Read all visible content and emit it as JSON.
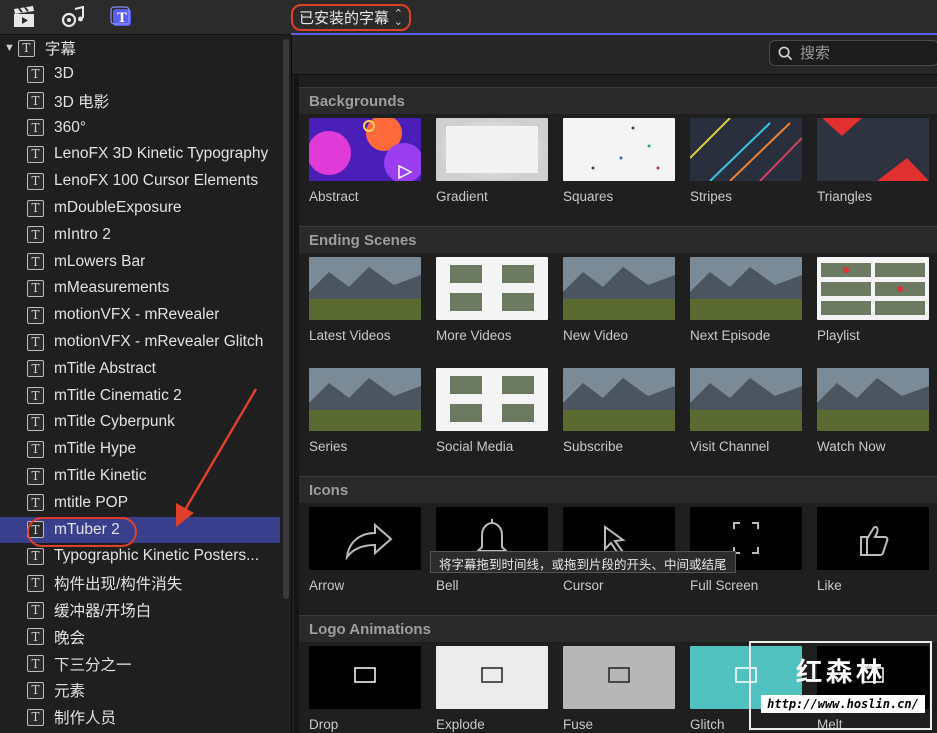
{
  "toolbar": {
    "icons": [
      "clapper-icon",
      "music-camera-icon",
      "titles-icon"
    ],
    "dropdown_label": "已安装的字幕"
  },
  "search": {
    "placeholder": "搜索"
  },
  "sidebar": {
    "root_label": "字幕",
    "items": [
      "3D",
      "3D 电影",
      "360°",
      "LenoFX 3D Kinetic Typography",
      "LenoFX 100 Cursor Elements",
      "mDoubleExposure",
      "mIntro 2",
      "mLowers Bar",
      "mMeasurements",
      "motionVFX - mRevealer",
      "motionVFX - mRevealer Glitch",
      "mTitle Abstract",
      "mTitle Cinematic 2",
      "mTitle Cyberpunk",
      "mTitle Hype",
      "mTitle Kinetic",
      "mtitle POP",
      "mTuber 2",
      "Typographic Kinetic Posters...",
      "构件出现/构件消失",
      "缓冲器/开场白",
      "晚会",
      "下三分之一",
      "元素",
      "制作人员"
    ],
    "selected_index": 17
  },
  "sections": [
    {
      "title": "Backgrounds",
      "rows": [
        [
          "Abstract",
          "Gradient",
          "Squares",
          "Stripes",
          "Triangles"
        ]
      ]
    },
    {
      "title": "Ending Scenes",
      "rows": [
        [
          "Latest Videos",
          "More Videos",
          "New Video",
          "Next Episode",
          "Playlist"
        ],
        [
          "Series",
          "Social Media",
          "Subscribe",
          "Visit Channel",
          "Watch Now"
        ]
      ]
    },
    {
      "title": "Icons",
      "rows": [
        [
          "Arrow",
          "Bell",
          "Cursor",
          "Full Screen",
          "Like"
        ]
      ]
    },
    {
      "title": "Logo Animations",
      "rows": [
        [
          "Drop",
          "Explode",
          "Fuse",
          "Glitch",
          "Melt"
        ]
      ]
    }
  ],
  "tooltip": "将字幕拖到时间线，或拖到片段的开头、中间或结尾",
  "watermark": {
    "title": "红森林",
    "url": "http://www.hoslin.cn/"
  },
  "colors": {
    "accent": "#3a3f8c",
    "annotation": "#e0402a",
    "tab_underline": "#5a5df2"
  }
}
